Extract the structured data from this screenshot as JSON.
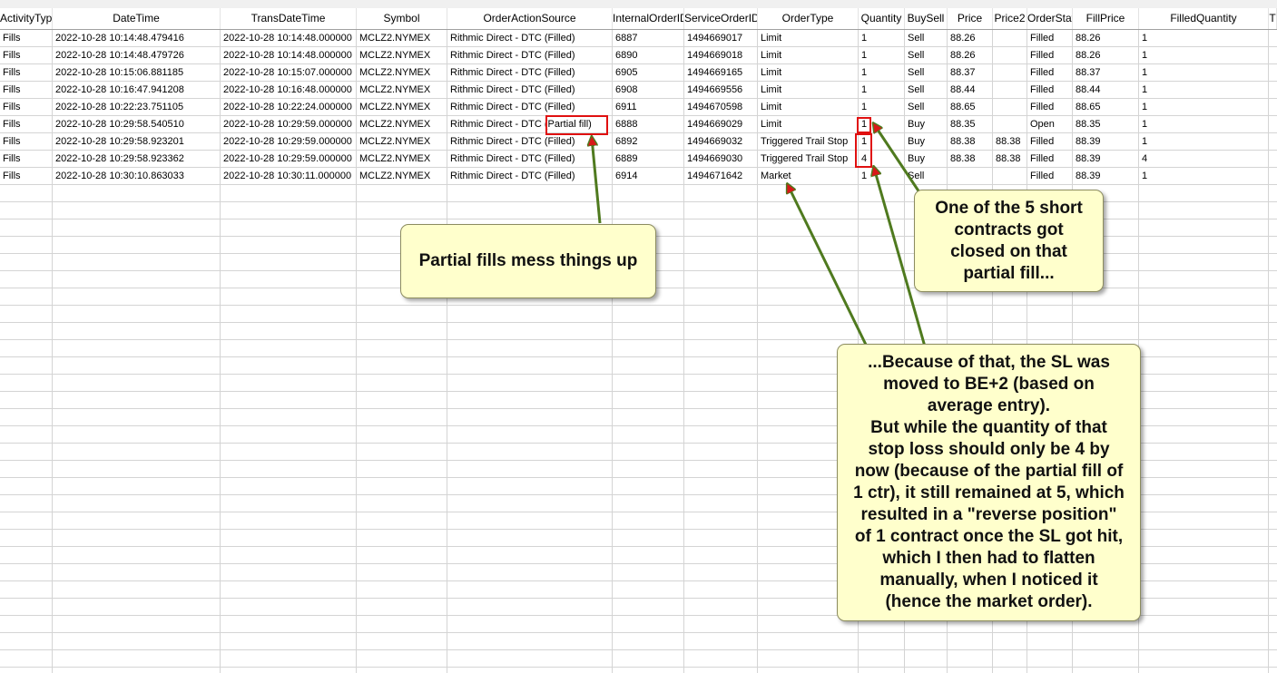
{
  "table": {
    "columns": [
      "ActivityType",
      "DateTime",
      "TransDateTime",
      "Symbol",
      "OrderActionSource",
      "InternalOrderID",
      "ServiceOrderID",
      "OrderType",
      "Quantity",
      "BuySell",
      "Price",
      "Price2",
      "OrderStatus",
      "FillPrice",
      "FilledQuantity",
      "T"
    ],
    "rows": [
      [
        "Fills",
        "2022-10-28  10:14:48.479416",
        "2022-10-28  10:14:48.000000",
        "MCLZ2.NYMEX",
        "Rithmic Direct - DTC (Filled)",
        "6887",
        "1494669017",
        "Limit",
        "1",
        "Sell",
        "88.26",
        "",
        "Filled",
        "88.26",
        "1"
      ],
      [
        "Fills",
        "2022-10-28  10:14:48.479726",
        "2022-10-28  10:14:48.000000",
        "MCLZ2.NYMEX",
        "Rithmic Direct - DTC (Filled)",
        "6890",
        "1494669018",
        "Limit",
        "1",
        "Sell",
        "88.26",
        "",
        "Filled",
        "88.26",
        "1"
      ],
      [
        "Fills",
        "2022-10-28  10:15:06.881185",
        "2022-10-28  10:15:07.000000",
        "MCLZ2.NYMEX",
        "Rithmic Direct - DTC (Filled)",
        "6905",
        "1494669165",
        "Limit",
        "1",
        "Sell",
        "88.37",
        "",
        "Filled",
        "88.37",
        "1"
      ],
      [
        "Fills",
        "2022-10-28  10:16:47.941208",
        "2022-10-28  10:16:48.000000",
        "MCLZ2.NYMEX",
        "Rithmic Direct - DTC (Filled)",
        "6908",
        "1494669556",
        "Limit",
        "1",
        "Sell",
        "88.44",
        "",
        "Filled",
        "88.44",
        "1"
      ],
      [
        "Fills",
        "2022-10-28  10:22:23.751105",
        "2022-10-28  10:22:24.000000",
        "MCLZ2.NYMEX",
        "Rithmic Direct - DTC (Filled)",
        "6911",
        "1494670598",
        "Limit",
        "1",
        "Sell",
        "88.65",
        "",
        "Filled",
        "88.65",
        "1"
      ],
      [
        "Fills",
        "2022-10-28  10:29:58.540510",
        "2022-10-28  10:29:59.000000",
        "MCLZ2.NYMEX",
        "Rithmic Direct - DTC (Partial fill)",
        "6888",
        "1494669029",
        "Limit",
        "1",
        "Buy",
        "88.35",
        "",
        "Open",
        "88.35",
        "1"
      ],
      [
        "Fills",
        "2022-10-28  10:29:58.923201",
        "2022-10-28  10:29:59.000000",
        "MCLZ2.NYMEX",
        "Rithmic Direct - DTC (Filled)",
        "6892",
        "1494669032",
        "Triggered Trail Stop",
        "1",
        "Buy",
        "88.38",
        "88.38",
        "Filled",
        "88.39",
        "1"
      ],
      [
        "Fills",
        "2022-10-28  10:29:58.923362",
        "2022-10-28  10:29:59.000000",
        "MCLZ2.NYMEX",
        "Rithmic Direct - DTC (Filled)",
        "6889",
        "1494669030",
        "Triggered Trail Stop",
        "4",
        "Buy",
        "88.38",
        "88.38",
        "Filled",
        "88.39",
        "4"
      ],
      [
        "Fills",
        "2022-10-28  10:30:10.863033",
        "2022-10-28  10:30:11.000000",
        "MCLZ2.NYMEX",
        "Rithmic Direct - DTC (Filled)",
        "6914",
        "1494671642",
        "Market",
        "1",
        "Sell",
        "",
        "",
        "Filled",
        "88.39",
        "1"
      ]
    ]
  },
  "callouts": {
    "partial": "Partial fills mess things up",
    "short": "One of the 5 short\ncontracts got\nclosed on that\npartial fill...",
    "because": "...Because of that, the SL was\nmoved to BE+2 (based on\naverage entry).\nBut while the quantity of that\nstop loss should only be 4 by\nnow (because of the partial fill of\n1 ctr), it still remained at 5, which\nresulted in a \"reverse position\"\nof 1 contract once the SL got hit,\nwhich I then had to flatten\nmanually, when I noticed it\n(hence the market order)."
  },
  "colors": {
    "highlight": "#e01010",
    "arrow": "#4f7a1f",
    "callout_bg": "#ffffcc",
    "grid": "#d4d4d4"
  }
}
